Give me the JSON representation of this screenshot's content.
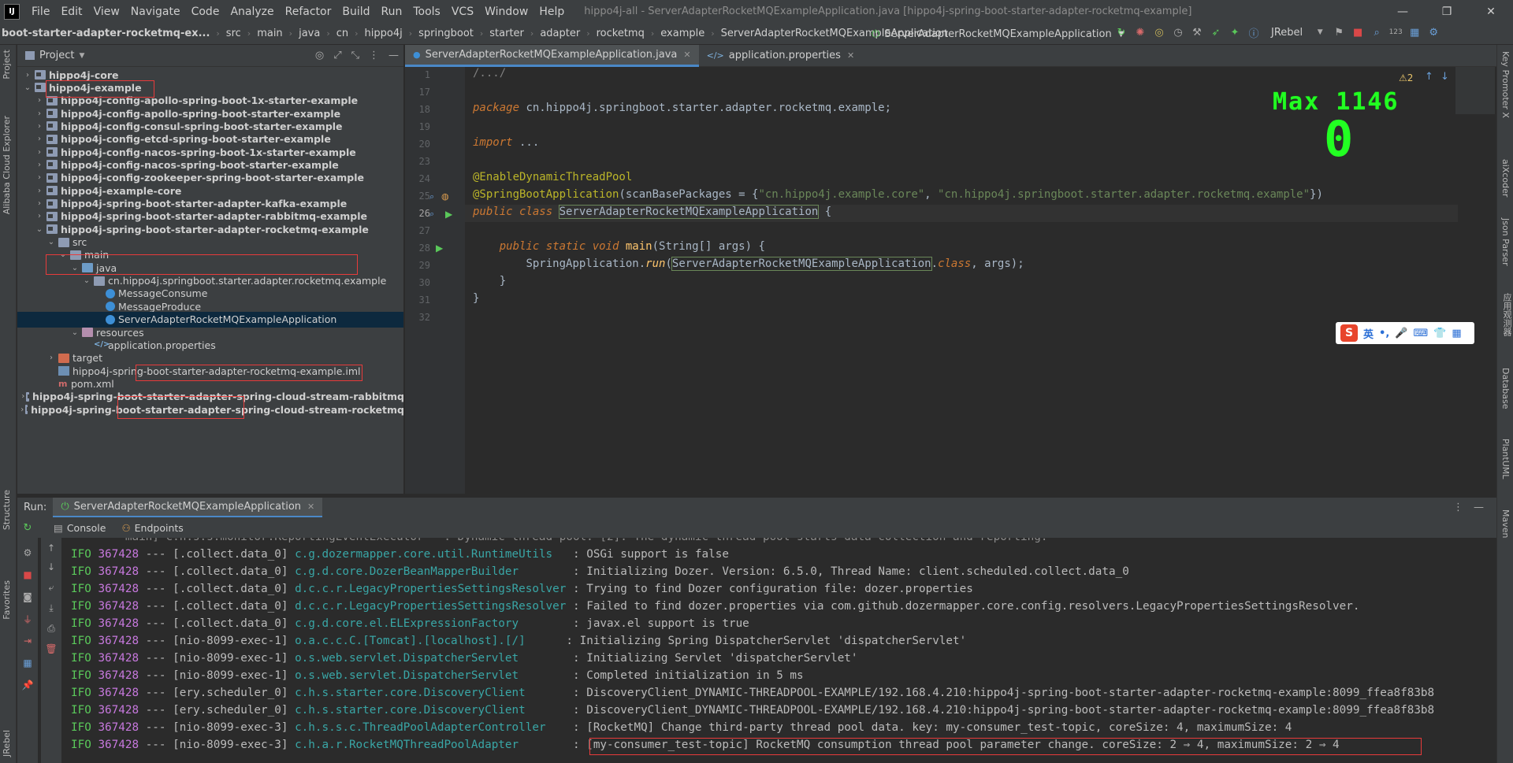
{
  "app": {
    "logo": "IJ",
    "menu": [
      "File",
      "Edit",
      "View",
      "Navigate",
      "Code",
      "Analyze",
      "Refactor",
      "Build",
      "Run",
      "Tools",
      "VCS",
      "Window",
      "Help"
    ],
    "window_title": "hippo4j-all - ServerAdapterRocketMQExampleApplication.java [hippo4j-spring-boot-starter-adapter-rocketmq-example]",
    "win_controls": [
      "—",
      "❐",
      "✕"
    ]
  },
  "navbar": {
    "breadcrumb": [
      "boot-starter-adapter-rocketmq-ex...",
      "src",
      "main",
      "java",
      "cn",
      "hippo4j",
      "springboot",
      "starter",
      "adapter",
      "rocketmq",
      "example",
      "ServerAdapterRocketMQExampleApplication"
    ],
    "run_config": "ServerAdapterRocketMQExampleApplication",
    "jrebel": "JRebel"
  },
  "left_strip": {
    "tabs": [
      "Project",
      "Alibaba Cloud Explorer",
      "Structure",
      "Favorites",
      "JRebel"
    ]
  },
  "right_strip": {
    "tabs": [
      "Key Promoter X",
      "aiXcoder",
      "Json Parser",
      "应用观测器",
      "Database",
      "PlantUML",
      "Maven"
    ]
  },
  "project": {
    "title": "Project",
    "tree": [
      {
        "label": "hippo4j-core",
        "depth": 1,
        "chev": "›",
        "icon": "folder-mod",
        "bold": true
      },
      {
        "label": "hippo4j-example",
        "depth": 1,
        "chev": "⌄",
        "icon": "folder-mod",
        "bold": true
      },
      {
        "label": "hippo4j-config-apollo-spring-boot-1x-starter-example",
        "depth": 2,
        "chev": "›",
        "icon": "folder-mod",
        "bold": true
      },
      {
        "label": "hippo4j-config-apollo-spring-boot-starter-example",
        "depth": 2,
        "chev": "›",
        "icon": "folder-mod",
        "bold": true
      },
      {
        "label": "hippo4j-config-consul-spring-boot-starter-example",
        "depth": 2,
        "chev": "›",
        "icon": "folder-mod",
        "bold": true
      },
      {
        "label": "hippo4j-config-etcd-spring-boot-starter-example",
        "depth": 2,
        "chev": "›",
        "icon": "folder-mod",
        "bold": true
      },
      {
        "label": "hippo4j-config-nacos-spring-boot-1x-starter-example",
        "depth": 2,
        "chev": "›",
        "icon": "folder-mod",
        "bold": true
      },
      {
        "label": "hippo4j-config-nacos-spring-boot-starter-example",
        "depth": 2,
        "chev": "›",
        "icon": "folder-mod",
        "bold": true
      },
      {
        "label": "hippo4j-config-zookeeper-spring-boot-starter-example",
        "depth": 2,
        "chev": "›",
        "icon": "folder-mod",
        "bold": true
      },
      {
        "label": "hippo4j-example-core",
        "depth": 2,
        "chev": "›",
        "icon": "folder-mod",
        "bold": true
      },
      {
        "label": "hippo4j-spring-boot-starter-adapter-kafka-example",
        "depth": 2,
        "chev": "›",
        "icon": "folder-mod",
        "bold": true
      },
      {
        "label": "hippo4j-spring-boot-starter-adapter-rabbitmq-example",
        "depth": 2,
        "chev": "›",
        "icon": "folder-mod",
        "bold": true
      },
      {
        "label": "hippo4j-spring-boot-starter-adapter-rocketmq-example",
        "depth": 2,
        "chev": "⌄",
        "icon": "folder-mod",
        "bold": true
      },
      {
        "label": "src",
        "depth": 3,
        "chev": "⌄",
        "icon": "folder-plain",
        "bold": false
      },
      {
        "label": "main",
        "depth": 4,
        "chev": "⌄",
        "icon": "folder-plain",
        "bold": false
      },
      {
        "label": "java",
        "depth": 5,
        "chev": "⌄",
        "icon": "folder-src",
        "bold": false
      },
      {
        "label": "cn.hippo4j.springboot.starter.adapter.rocketmq.example",
        "depth": 6,
        "chev": "⌄",
        "icon": "pkg",
        "bold": false
      },
      {
        "label": "MessageConsume",
        "depth": 7,
        "chev": "",
        "icon": "java-cls",
        "bold": false
      },
      {
        "label": "MessageProduce",
        "depth": 7,
        "chev": "",
        "icon": "java-cls",
        "bold": false
      },
      {
        "label": "ServerAdapterRocketMQExampleApplication",
        "depth": 7,
        "chev": "",
        "icon": "java-cls",
        "bold": false,
        "selected": true
      },
      {
        "label": "resources",
        "depth": 5,
        "chev": "⌄",
        "icon": "folder-res",
        "bold": false
      },
      {
        "label": "application.properties",
        "depth": 6,
        "chev": "",
        "icon": "props-ico",
        "bold": false
      },
      {
        "label": "target",
        "depth": 3,
        "chev": "›",
        "icon": "folder-target",
        "bold": false
      },
      {
        "label": "hippo4j-spring-boot-starter-adapter-rocketmq-example.iml",
        "depth": 3,
        "chev": "",
        "icon": "iml-ico",
        "bold": false
      },
      {
        "label": "pom.xml",
        "depth": 3,
        "chev": "",
        "icon": "maven-ico",
        "bold": false
      },
      {
        "label": "hippo4j-spring-boot-starter-adapter-spring-cloud-stream-rabbitmq",
        "depth": 2,
        "chev": "›",
        "icon": "folder-mod",
        "bold": true
      },
      {
        "label": "hippo4j-spring-boot-starter-adapter-spring-cloud-stream-rocketmq",
        "depth": 2,
        "chev": "›",
        "icon": "folder-mod",
        "bold": true
      }
    ]
  },
  "editor": {
    "tabs": [
      {
        "label": "ServerAdapterRocketMQExampleApplication.java",
        "active": true
      },
      {
        "label": "application.properties",
        "active": false
      }
    ],
    "warnings": "⚠2",
    "line_numbers": [
      "1",
      "17",
      "18",
      "19",
      "20",
      "23",
      "24",
      "25",
      "26",
      "27",
      "28",
      "29",
      "30",
      "31",
      "32"
    ],
    "code": {
      "l1": "/.../",
      "l18_kw": "package",
      "l18_rest": " cn.hippo4j.springboot.starter.adapter.rocketmq.example;",
      "l20_kw": "import",
      "l20_rest": " ...",
      "l24": "@EnableDynamicThreadPool",
      "l25_ann": "@SpringBootApplication",
      "l25_mid": "(scanBasePackages = {",
      "l25_s1": "\"cn.hippo4j.example.core\"",
      "l25_comma": ", ",
      "l25_s2": "\"cn.hippo4j.springboot.starter.adapter.rocketmq.example\"",
      "l25_end": "})",
      "l26_kw": "public class ",
      "l26_cls": "ServerAdapterRocketMQExampleApplication",
      "l26_end": " {",
      "l28_kw": "public static void ",
      "l28_m": "main",
      "l28_end": "(String[] args) {",
      "l29_a": "SpringApplication.",
      "l29_m": "run",
      "l29_b": "(",
      "l29_cls": "ServerAdapterRocketMQExampleApplication",
      "l29_c": ".",
      "l29_kw": "class",
      "l29_d": ", args);",
      "l30": "}",
      "l31": "}"
    },
    "overlay_max": "Max 1146",
    "overlay_value": "0",
    "ime": {
      "logo": "S",
      "items": [
        "英",
        "•,",
        "🎤",
        "⌨",
        "👕",
        "▦"
      ]
    }
  },
  "run": {
    "label": "Run:",
    "tab": "ServerAdapterRocketMQExampleApplication",
    "subtabs": [
      "Console",
      "Endpoints"
    ],
    "log_top": "        main] c.h.s.s.monitor.ReportingEventExecutor   : Dynamic thread pool: [2]. The dynamic thread pool starts data collection and reporting.",
    "logs": [
      {
        "lvl": "IFO",
        "pid": "367428",
        "thread": "--- [.collect.data_0]",
        "logger": "c.g.dozermapper.core.util.RuntimeUtils  ",
        "msg": " : OSGi support is false"
      },
      {
        "lvl": "IFO",
        "pid": "367428",
        "thread": "--- [.collect.data_0]",
        "logger": "c.g.d.core.DozerBeanMapperBuilder       ",
        "msg": " : Initializing Dozer. Version: 6.5.0, Thread Name: client.scheduled.collect.data_0"
      },
      {
        "lvl": "IFO",
        "pid": "367428",
        "thread": "--- [.collect.data_0]",
        "logger": "d.c.c.r.LegacyPropertiesSettingsResolver",
        "msg": " : Trying to find Dozer configuration file: dozer.properties"
      },
      {
        "lvl": "IFO",
        "pid": "367428",
        "thread": "--- [.collect.data_0]",
        "logger": "d.c.c.r.LegacyPropertiesSettingsResolver",
        "msg": " : Failed to find dozer.properties via com.github.dozermapper.core.config.resolvers.LegacyPropertiesSettingsResolver."
      },
      {
        "lvl": "IFO",
        "pid": "367428",
        "thread": "--- [.collect.data_0]",
        "logger": "c.g.d.core.el.ELExpressionFactory       ",
        "msg": " : javax.el support is true"
      },
      {
        "lvl": "IFO",
        "pid": "367428",
        "thread": "--- [nio-8099-exec-1]",
        "logger": "o.a.c.c.C.[Tomcat].[localhost].[/]     ",
        "msg": " : Initializing Spring DispatcherServlet 'dispatcherServlet'"
      },
      {
        "lvl": "IFO",
        "pid": "367428",
        "thread": "--- [nio-8099-exec-1]",
        "logger": "o.s.web.servlet.DispatcherServlet       ",
        "msg": " : Initializing Servlet 'dispatcherServlet'"
      },
      {
        "lvl": "IFO",
        "pid": "367428",
        "thread": "--- [nio-8099-exec-1]",
        "logger": "o.s.web.servlet.DispatcherServlet       ",
        "msg": " : Completed initialization in 5 ms"
      },
      {
        "lvl": "IFO",
        "pid": "367428",
        "thread": "--- [ery.scheduler_0]",
        "logger": "c.h.s.starter.core.DiscoveryClient      ",
        "msg": " : DiscoveryClient_DYNAMIC-THREADPOOL-EXAMPLE/192.168.4.210:hippo4j-spring-boot-starter-adapter-rocketmq-example:8099_ffea8f83b8"
      },
      {
        "lvl": "IFO",
        "pid": "367428",
        "thread": "--- [ery.scheduler_0]",
        "logger": "c.h.s.starter.core.DiscoveryClient      ",
        "msg": " : DiscoveryClient_DYNAMIC-THREADPOOL-EXAMPLE/192.168.4.210:hippo4j-spring-boot-starter-adapter-rocketmq-example:8099_ffea8f83b8"
      },
      {
        "lvl": "IFO",
        "pid": "367428",
        "thread": "--- [nio-8099-exec-3]",
        "logger": "c.h.s.s.c.ThreadPoolAdapterController   ",
        "msg": " : [RocketMQ] Change third-party thread pool data. key: my-consumer_test-topic, coreSize: 4, maximumSize: 4"
      },
      {
        "lvl": "IFO",
        "pid": "367428",
        "thread": "--- [nio-8099-exec-3]",
        "logger": "c.h.a.r.RocketMQThreadPoolAdapter       ",
        "msg": " : [my-consumer_test-topic] RocketMQ consumption thread pool parameter change. coreSize: 2 ⇒ 4, maximumSize: 2 ⇒ 4"
      }
    ]
  }
}
